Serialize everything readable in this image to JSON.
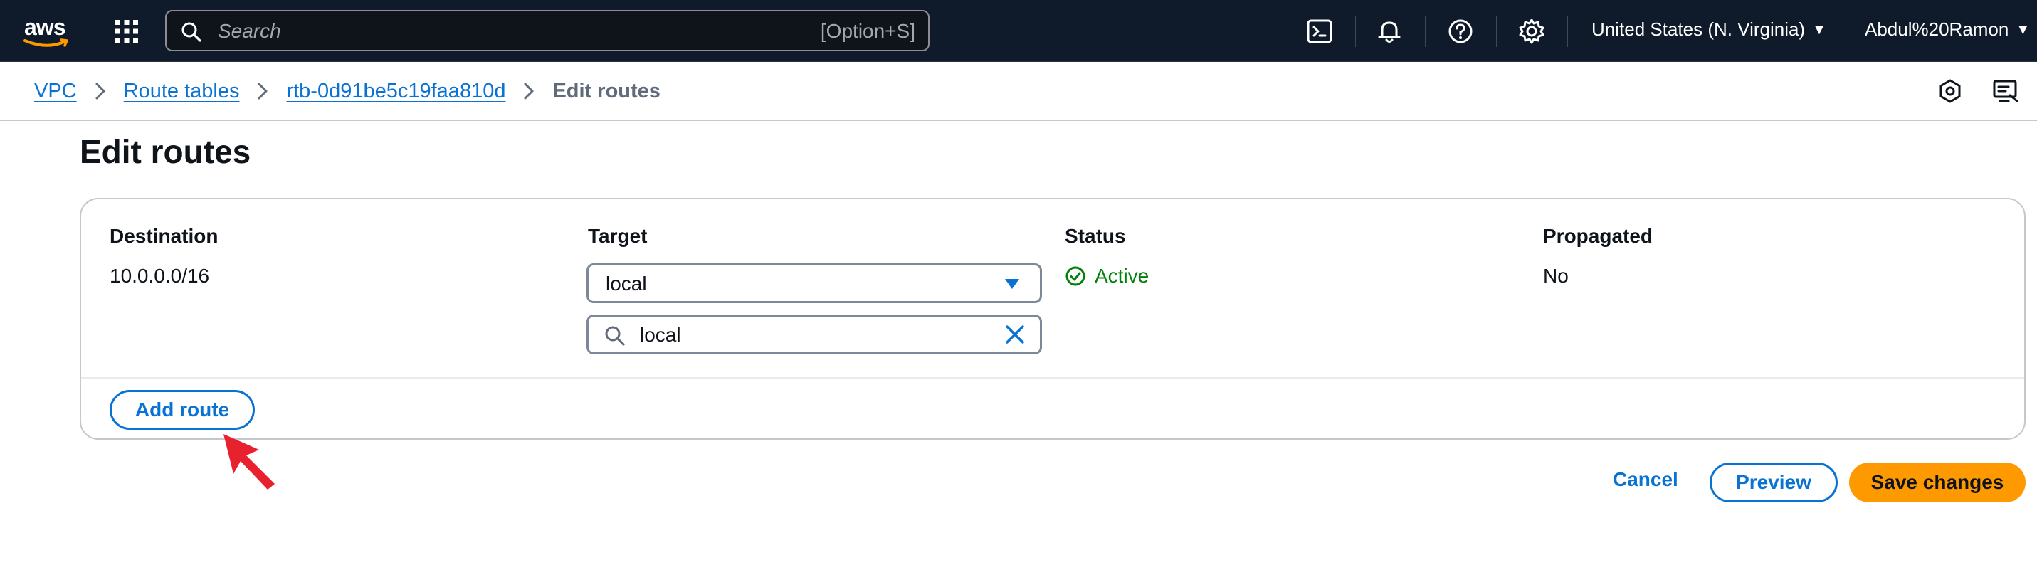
{
  "topnav": {
    "logo_text": "aws",
    "search_placeholder": "Search",
    "search_shortcut": "[Option+S]",
    "region": "United States (N. Virginia)",
    "user": "Abdul%20Ramon",
    "icons": [
      "apps-grid-icon",
      "cloudshell-icon",
      "notifications-bell-icon",
      "help-icon",
      "settings-gear-icon"
    ]
  },
  "breadcrumb": {
    "items": [
      "VPC",
      "Route tables",
      "rtb-0d91be5c19faa810d"
    ],
    "current": "Edit routes"
  },
  "page": {
    "title": "Edit routes"
  },
  "routes_table": {
    "columns": [
      "Destination",
      "Target",
      "Status",
      "Propagated"
    ],
    "rows": [
      {
        "destination": "10.0.0.0/16",
        "target": "local",
        "target_filter": "local",
        "status": "Active",
        "propagated": "No"
      }
    ],
    "add_route_label": "Add route"
  },
  "actions": {
    "cancel": "Cancel",
    "preview": "Preview",
    "save": "Save changes"
  },
  "colors": {
    "nav_bg": "#0f1b2a",
    "link_blue": "#0972d3",
    "status_green": "#037f0c",
    "primary_orange": "#ff9900",
    "pointer_red": "#e8212e"
  }
}
